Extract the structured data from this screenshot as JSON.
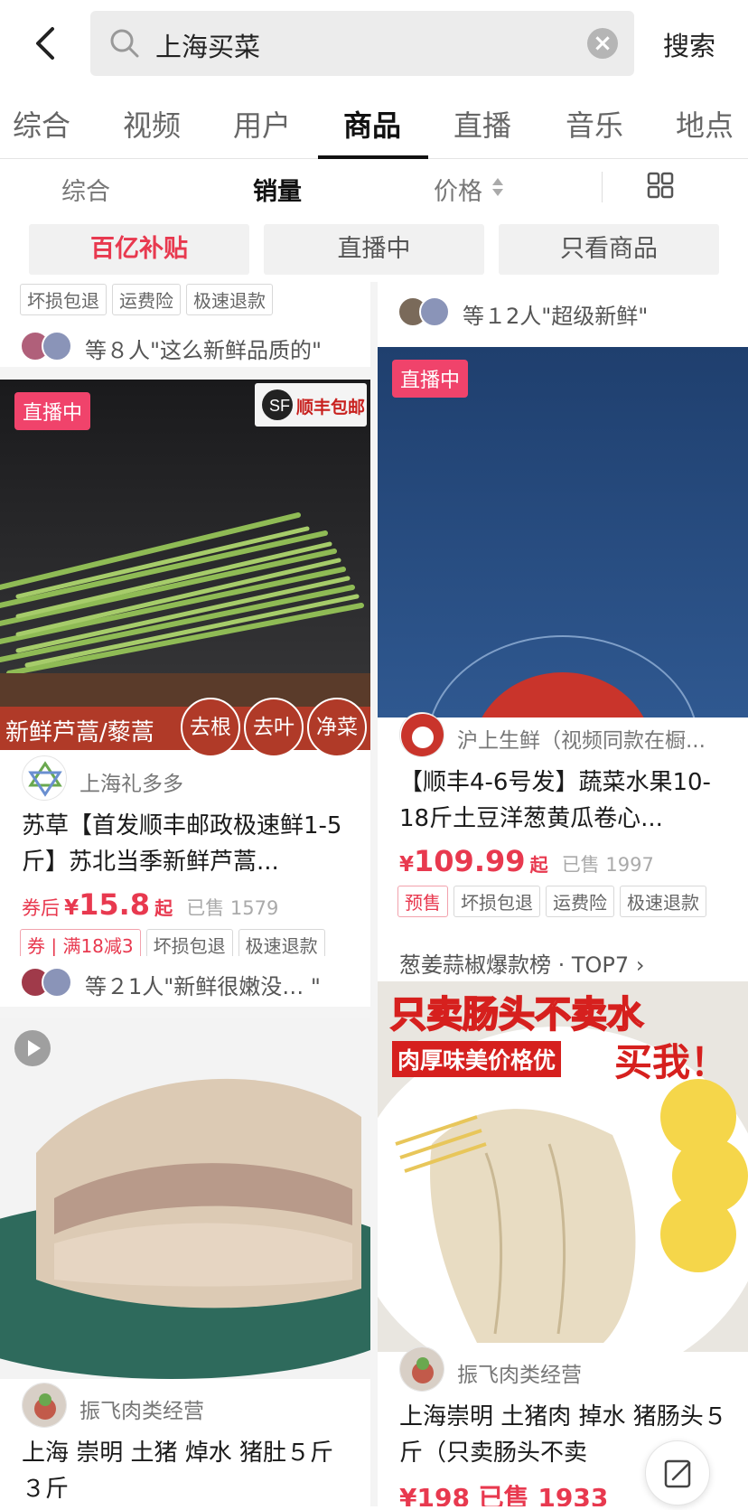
{
  "search": {
    "query": "上海买菜",
    "button_label": "搜索"
  },
  "tabs": [
    {
      "label": "综合"
    },
    {
      "label": "视频"
    },
    {
      "label": "用户"
    },
    {
      "label": "商品"
    },
    {
      "label": "直播"
    },
    {
      "label": "音乐"
    },
    {
      "label": "地点"
    }
  ],
  "active_tab": "商品",
  "sort": {
    "general": "综合",
    "sales": "销量",
    "price": "价格"
  },
  "chips": [
    {
      "label": "百亿补贴"
    },
    {
      "label": "直播中"
    },
    {
      "label": "只看商品"
    }
  ],
  "colors": {
    "accent": "#e8394f",
    "live": "#f0436b",
    "underline": "#111111"
  },
  "products": {
    "top_left_partial": {
      "tags": [
        "坏损包退",
        "运费险",
        "极速退款"
      ],
      "favor_text": "等８人\"这么新鲜品质的\""
    },
    "top_right_partial": {
      "favor_text": "等１2人\"超级新鲜\""
    },
    "p1": {
      "live": "直播中",
      "image_banner": "新鲜芦蒿/藜蒿",
      "image_circles": [
        "去根",
        "去叶",
        "净菜"
      ],
      "image_corner": "顺丰包邮",
      "shop": "上海礼多多",
      "title": "苏草【首发顺丰邮政极速鲜1-5斤】苏北当季新鲜芦蒿...",
      "price_prefix": "券后",
      "currency": "¥",
      "price": "15.8",
      "price_suffix": "起",
      "sold": "已售 1579",
      "coupon": "券",
      "coupon_text": "满18减3",
      "tags": [
        "坏损包退",
        "极速退款"
      ],
      "favor_text": "等２1人\"新鲜很嫩没…   \""
    },
    "p2": {
      "live": "直播中",
      "shop": "沪上生鲜（视频同款在橱...",
      "title": "【顺丰4-6号发】蔬菜水果10-18斤土豆洋葱黄瓜卷心...",
      "currency": "¥",
      "price": "109.99",
      "price_suffix": "起",
      "sold": "已售 1997",
      "tags_red": [
        "预售"
      ],
      "tags": [
        "坏损包退",
        "运费险",
        "极速退款"
      ],
      "rank": "葱姜蒜椒爆款榜 · TOP7"
    },
    "p3": {
      "shop": "振飞肉类经营",
      "title": "上海 崇明 土猪 焯水 猪肚５斤３斤"
    },
    "p4": {
      "image_text_top": "只卖肠头不卖水",
      "image_text_mid": "肉厚味美价格优",
      "image_text_right": "买我！",
      "shop": "振飞肉类经营",
      "title": "上海崇明 土猪肉  掉水 猪肠头５斤（只卖肠头不卖",
      "price": "¥198  已售 1933"
    }
  }
}
